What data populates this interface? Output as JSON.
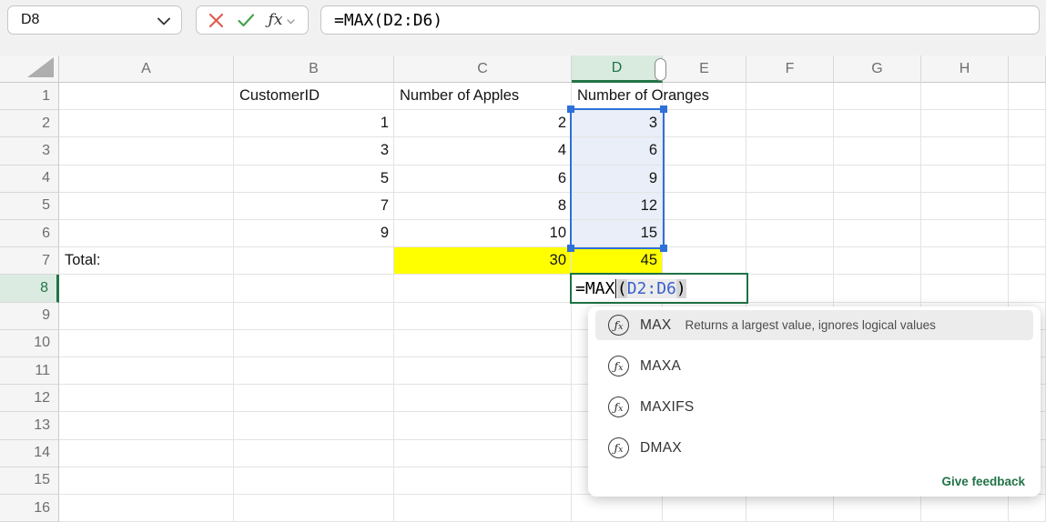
{
  "toolbar": {
    "name_box": "D8",
    "formula_bar": "=MAX(D2:D6)",
    "icons": {
      "name_box_dropdown": "chevron-down-icon",
      "cancel": "x-icon",
      "confirm": "check-icon",
      "insert_function": "fx-icon",
      "fx_dropdown": "chevron-down-small-icon"
    }
  },
  "grid": {
    "column_labels": [
      "A",
      "B",
      "C",
      "D",
      "E",
      "F",
      "G",
      "H",
      ""
    ],
    "row_labels": [
      "1",
      "2",
      "3",
      "4",
      "5",
      "6",
      "7",
      "8",
      "9",
      "10",
      "11",
      "12",
      "13",
      "14",
      "15",
      "16"
    ],
    "selected_column": "D",
    "selected_row": "8",
    "selected_range": "D2:D6",
    "active_cell": "D8",
    "cells": [
      {
        "ref": "B1",
        "text": "CustomerID",
        "align": "left"
      },
      {
        "ref": "C1",
        "text": "Number of Apples",
        "align": "left"
      },
      {
        "ref": "D1",
        "text": "Number of Oranges",
        "align": "left",
        "spill": true
      },
      {
        "ref": "B2",
        "text": "1",
        "align": "right"
      },
      {
        "ref": "B3",
        "text": "3",
        "align": "right"
      },
      {
        "ref": "B4",
        "text": "5",
        "align": "right"
      },
      {
        "ref": "B5",
        "text": "7",
        "align": "right"
      },
      {
        "ref": "B6",
        "text": "9",
        "align": "right"
      },
      {
        "ref": "C2",
        "text": "2",
        "align": "right"
      },
      {
        "ref": "C3",
        "text": "4",
        "align": "right"
      },
      {
        "ref": "C4",
        "text": "6",
        "align": "right"
      },
      {
        "ref": "C5",
        "text": "8",
        "align": "right"
      },
      {
        "ref": "C6",
        "text": "10",
        "align": "right"
      },
      {
        "ref": "D2",
        "text": "3",
        "align": "right",
        "fill": "blue"
      },
      {
        "ref": "D3",
        "text": "6",
        "align": "right",
        "fill": "blue"
      },
      {
        "ref": "D4",
        "text": "9",
        "align": "right",
        "fill": "blue"
      },
      {
        "ref": "D5",
        "text": "12",
        "align": "right",
        "fill": "blue"
      },
      {
        "ref": "D6",
        "text": "15",
        "align": "right",
        "fill": "blue"
      },
      {
        "ref": "A7",
        "text": "Total:",
        "align": "left"
      },
      {
        "ref": "C7",
        "text": "30",
        "align": "right",
        "highlight": "yellow"
      },
      {
        "ref": "D7",
        "text": "45",
        "align": "right",
        "highlight": "yellow"
      }
    ],
    "edit_cell": {
      "ref": "D8",
      "tokens": [
        {
          "t": "=MAX",
          "c": "plain"
        },
        {
          "t": "",
          "c": "caret"
        },
        {
          "t": "(",
          "c": "paren"
        },
        {
          "t": "D2:D6",
          "c": "range"
        },
        {
          "t": ")",
          "c": "paren"
        }
      ]
    }
  },
  "autocomplete": {
    "items": [
      {
        "name": "MAX",
        "description": "Returns a largest value, ignores logical values",
        "selected": true
      },
      {
        "name": "MAXA",
        "description": "",
        "selected": false
      },
      {
        "name": "MAXIFS",
        "description": "",
        "selected": false
      },
      {
        "name": "DMAX",
        "description": "",
        "selected": false
      }
    ],
    "footer_link": "Give feedback"
  },
  "colors": {
    "accent_green": "#217346",
    "selection_blue": "#2E70D9",
    "range_text_blue": "#3A5FCD",
    "highlight_yellow": "#FFFF00",
    "selected_header_green_bg": "#D9EADF",
    "selection_fill_blue": "#E9EEF8"
  }
}
